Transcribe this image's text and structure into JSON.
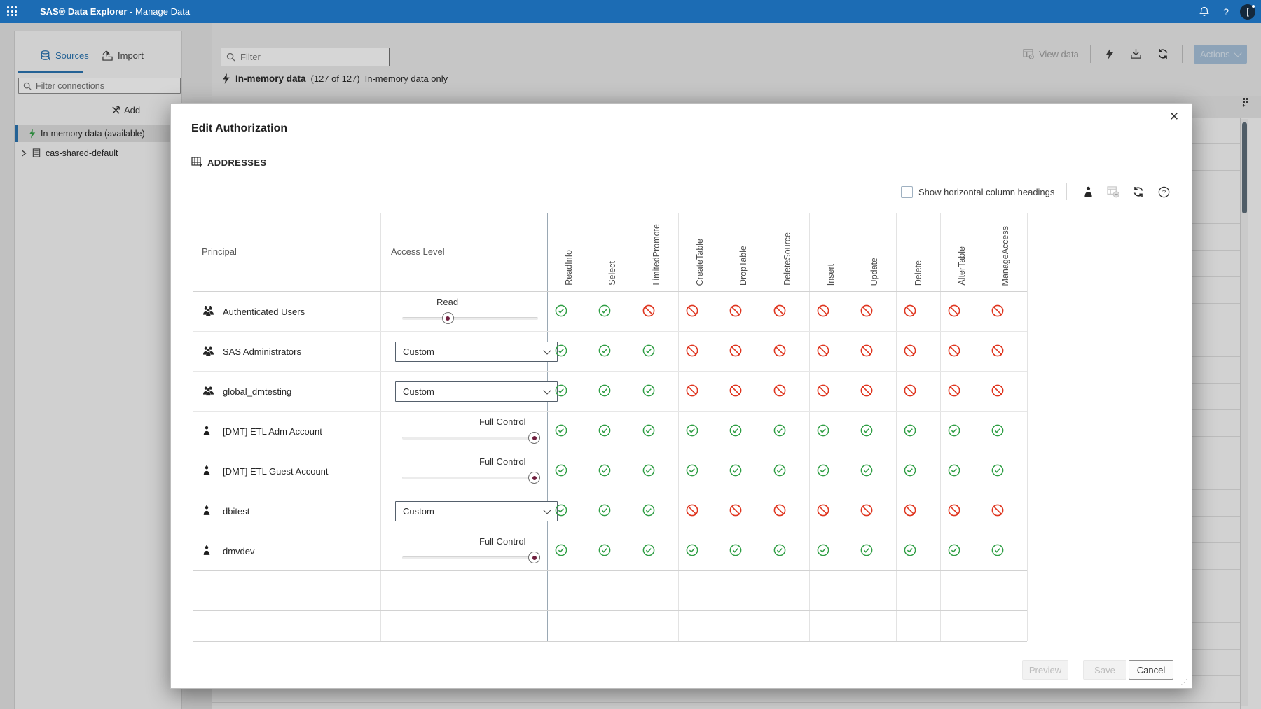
{
  "titlebar": {
    "app_name": "SAS® Data Explorer",
    "app_subtitle": " - Manage Data",
    "help_glyph": "?",
    "avatar_text": "["
  },
  "sidebar": {
    "tabs": [
      {
        "label": "Sources",
        "active": true
      },
      {
        "label": "Import",
        "active": false
      }
    ],
    "filter_placeholder": "Filter connections",
    "add_label": "Add",
    "tree": [
      {
        "label": "In-memory data (available)",
        "icon": "bolt",
        "selected": true
      },
      {
        "label": "cas-shared-default",
        "icon": "library",
        "expandable": true
      }
    ]
  },
  "main": {
    "filter_placeholder": "Filter",
    "summary_title": "In-memory data",
    "summary_count": "(127 of 127)",
    "summary_note": "In-memory data only",
    "toolbar": {
      "view_data_label": "View data",
      "actions_label": "Actions"
    }
  },
  "dialog": {
    "title": "Edit Authorization",
    "object_name": "ADDRESSES",
    "close_glyph": "✕",
    "show_headings_label": "Show horizontal column headings",
    "table": {
      "principal_header": "Principal",
      "access_level_header": "Access Level",
      "permission_columns": [
        "ReadInfo",
        "Select",
        "LimitedPromote",
        "CreateTable",
        "DropTable",
        "DeleteSource",
        "Insert",
        "Update",
        "Delete",
        "AlterTable",
        "ManageAccess"
      ],
      "rows": [
        {
          "principal": "Authenticated Users",
          "principal_type": "group",
          "control": "slider",
          "access_label": "Read",
          "slider_percent": 33.5,
          "permissions": [
            "allow",
            "allow",
            "deny",
            "deny",
            "deny",
            "deny",
            "deny",
            "deny",
            "deny",
            "deny",
            "deny"
          ]
        },
        {
          "principal": "SAS Administrators",
          "principal_type": "group",
          "control": "select",
          "access_value": "Custom",
          "permissions": [
            "allow",
            "allow",
            "allow",
            "deny",
            "deny",
            "deny",
            "deny",
            "deny",
            "deny",
            "deny",
            "deny"
          ]
        },
        {
          "principal": "global_dmtesting",
          "principal_type": "group",
          "control": "select",
          "access_value": "Custom",
          "permissions": [
            "allow",
            "allow",
            "allow",
            "deny",
            "deny",
            "deny",
            "deny",
            "deny",
            "deny",
            "deny",
            "deny"
          ]
        },
        {
          "principal": "[DMT] ETL Adm Account",
          "principal_type": "user",
          "control": "slider",
          "access_label": "Full Control",
          "slider_percent": 97,
          "permissions": [
            "allow",
            "allow",
            "allow",
            "allow",
            "allow",
            "allow",
            "allow",
            "allow",
            "allow",
            "allow",
            "allow"
          ]
        },
        {
          "principal": "[DMT] ETL Guest Account",
          "principal_type": "user",
          "control": "slider",
          "access_label": "Full Control",
          "slider_percent": 97,
          "permissions": [
            "allow",
            "allow",
            "allow",
            "allow",
            "allow",
            "allow",
            "allow",
            "allow",
            "allow",
            "allow",
            "allow"
          ]
        },
        {
          "principal": "dbitest",
          "principal_type": "user",
          "control": "select",
          "access_value": "Custom",
          "permissions": [
            "allow",
            "allow",
            "allow",
            "deny",
            "deny",
            "deny",
            "deny",
            "deny",
            "deny",
            "deny",
            "deny"
          ]
        },
        {
          "principal": "dmvdev",
          "principal_type": "user",
          "control": "slider",
          "access_label": "Full Control",
          "slider_percent": 97,
          "permissions": [
            "allow",
            "allow",
            "allow",
            "allow",
            "allow",
            "allow",
            "allow",
            "allow",
            "allow",
            "allow",
            "allow"
          ]
        }
      ]
    },
    "buttons": [
      {
        "label": "Preview",
        "enabled": false
      },
      {
        "label": "Save",
        "enabled": false
      },
      {
        "label": "Cancel",
        "enabled": true
      }
    ],
    "resize_glyph": "⋰"
  },
  "colors": {
    "banner_blue": "#1c6cb4",
    "accent_blue": "#2670ae",
    "allow_green": "#2f9e44",
    "deny_red": "#df351f",
    "slider_thumb_dot": "#70203f"
  }
}
